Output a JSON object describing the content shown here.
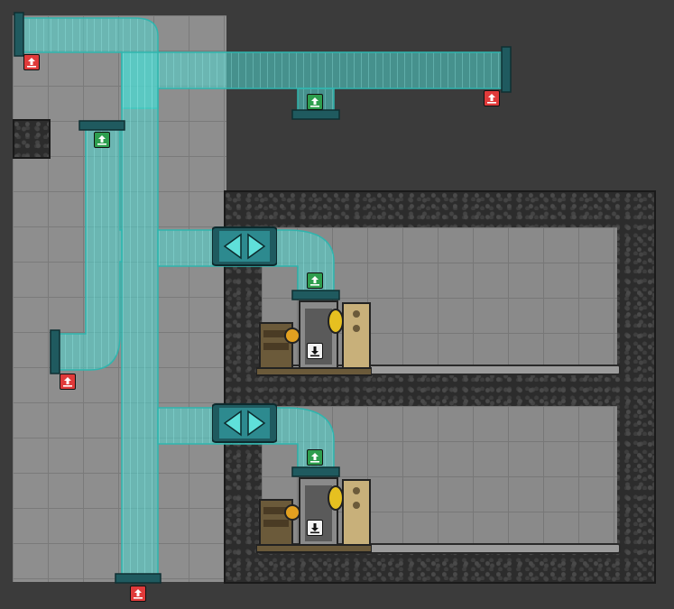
{
  "view": {
    "name": "gas-pipe-overlay",
    "colors": {
      "background": "#3b3b3b",
      "pipe": "#4fd6cf",
      "pipe_edge": "#2fb5ae",
      "output_port": "#e03a3a",
      "input_port": "#2e9e4e",
      "receiver_port": "#f2f2f2",
      "wall": "#2c2c2c"
    }
  },
  "icons": {
    "output": "arrow-out-icon",
    "input": "arrow-in-icon",
    "receive": "arrow-down-icon",
    "valve": "shutoff-valve-icon",
    "machine": "gas-generator-icon"
  },
  "ports": [
    {
      "type": "output",
      "name": "vent-output-top-left"
    },
    {
      "type": "output",
      "name": "vent-output-top-right"
    },
    {
      "type": "input",
      "name": "intake-top-center"
    },
    {
      "type": "input",
      "name": "intake-upper-left"
    },
    {
      "type": "output",
      "name": "vent-output-mid-left"
    },
    {
      "type": "output",
      "name": "vent-output-bottom"
    },
    {
      "type": "input",
      "name": "machine-1-input"
    },
    {
      "type": "input",
      "name": "machine-2-input"
    },
    {
      "type": "receive",
      "name": "machine-1-receiver"
    },
    {
      "type": "receive",
      "name": "machine-2-receiver"
    }
  ]
}
